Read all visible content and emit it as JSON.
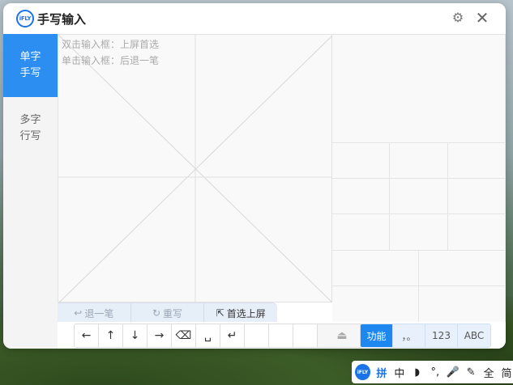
{
  "window": {
    "logo_text": "iFLY",
    "title": "手写输入",
    "gear_icon": "gear-icon",
    "close_icon": "close-icon"
  },
  "sidebar": {
    "items": [
      {
        "label": "单字\n手写",
        "active": true
      },
      {
        "label": "多字\n行写",
        "active": false
      }
    ]
  },
  "canvas": {
    "hints": [
      "双击输入框：上屏首选",
      "单击输入框：后退一笔"
    ]
  },
  "actions": [
    {
      "icon": "↩",
      "label": "退一笔"
    },
    {
      "icon": "↻",
      "label": "重写"
    },
    {
      "icon": "⇱",
      "label": "首选上屏"
    }
  ],
  "keys": [
    "←",
    "↑",
    "↓",
    "→",
    "⌫",
    "␣",
    "↵",
    "",
    "",
    "",
    "⏏"
  ],
  "mode_buttons": [
    {
      "label": "功能",
      "active": true
    },
    {
      "label": "，。",
      "active": false
    },
    {
      "label": "123",
      "active": false
    },
    {
      "label": "ABC",
      "active": false
    }
  ],
  "taskbar": {
    "logo_text": "iFLY",
    "items": [
      "拼",
      "中",
      "◗",
      "°,",
      "🎤",
      "✎",
      "全",
      "简"
    ]
  },
  "colors": {
    "accent": "#2b8ef0",
    "accent_dark": "#1e87f0"
  }
}
